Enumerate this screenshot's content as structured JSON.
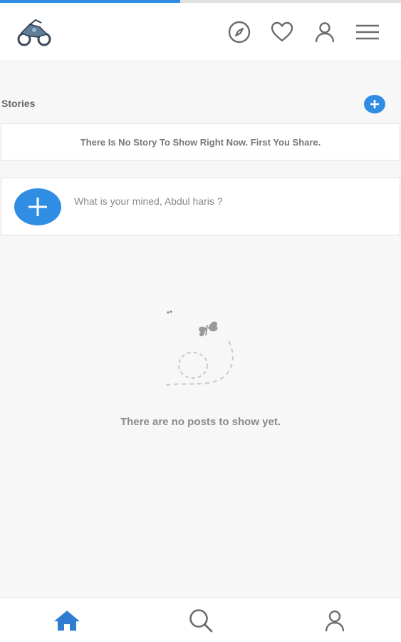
{
  "progress": {
    "percent": 45,
    "color": "#2f8de4"
  },
  "header": {
    "logo": "bike-logo",
    "icons": [
      "compass-icon",
      "heart-icon",
      "user-icon",
      "menu-icon"
    ]
  },
  "stories": {
    "label": "Stories",
    "add_icon": "plus-icon",
    "empty_message": "There Is No Story To Show Right Now. First You Share."
  },
  "composer": {
    "add_icon": "plus-icon",
    "placeholder": "What is your mined, Abdul haris ?"
  },
  "feed": {
    "empty_icon": "butterfly-path-icon",
    "empty_message": "There are no posts to show yet."
  },
  "bottom_nav": {
    "items": [
      "home-icon",
      "search-icon",
      "profile-icon"
    ],
    "active_color": "#2f7dd1"
  },
  "colors": {
    "accent": "#2f8de4",
    "background": "#f7f7f7"
  }
}
